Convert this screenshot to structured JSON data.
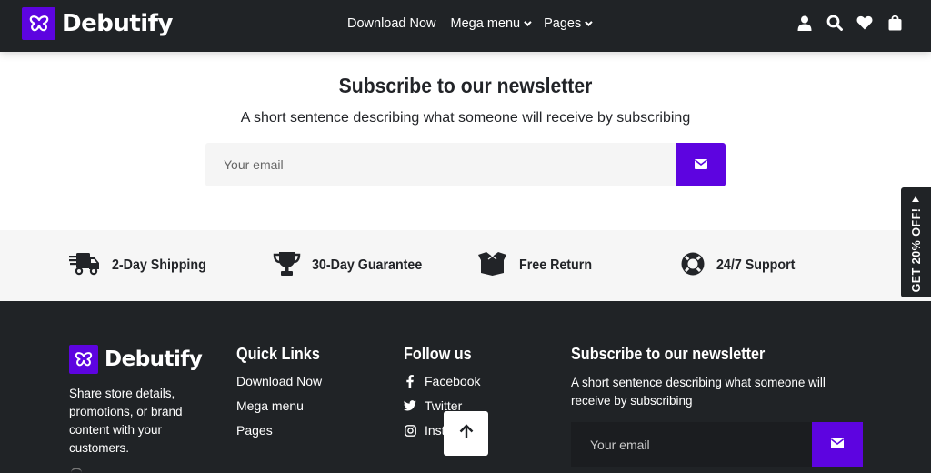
{
  "header": {
    "brand": "Debutify",
    "nav": [
      {
        "label": "Download Now",
        "has_dropdown": false
      },
      {
        "label": "Mega menu",
        "has_dropdown": true
      },
      {
        "label": "Pages",
        "has_dropdown": true
      }
    ],
    "icons": [
      "user-icon",
      "search-icon",
      "heart-icon",
      "shopping-bag-icon"
    ]
  },
  "newsletter": {
    "title": "Subscribe to our newsletter",
    "subtitle": "A short sentence describing what someone will receive by subscribing",
    "email_placeholder": "Your email",
    "submit_icon": "envelope-icon"
  },
  "features": [
    {
      "icon": "truck-icon",
      "label": "2-Day Shipping"
    },
    {
      "icon": "trophy-icon",
      "label": "30-Day Guarantee"
    },
    {
      "icon": "open-box-icon",
      "label": "Free Return"
    },
    {
      "icon": "life-ring-icon",
      "label": "24/7 Support"
    }
  ],
  "side_tab": {
    "label": "GET 20% OFF!"
  },
  "footer": {
    "brand": "Debutify",
    "description": "Share store details, promotions, or brand content with your customers.",
    "quick_links": {
      "title": "Quick Links",
      "items": [
        "Download Now",
        "Mega menu",
        "Pages"
      ]
    },
    "follow_us": {
      "title": "Follow us",
      "items": [
        {
          "icon": "facebook-icon",
          "label": "Facebook"
        },
        {
          "icon": "twitter-icon",
          "label": "Twitter"
        },
        {
          "icon": "instagram-icon",
          "label": "Instagram"
        }
      ]
    },
    "newsletter": {
      "title": "Subscribe to our newsletter",
      "subtitle": "A short sentence describing what someone will receive by subscribing",
      "email_placeholder": "Your email"
    }
  },
  "back_to_top": {
    "icon": "arrow-up-icon"
  },
  "colors": {
    "brand_purple": "#5d04e0",
    "dark": "#202326",
    "light_gray": "#f6f6f6"
  }
}
